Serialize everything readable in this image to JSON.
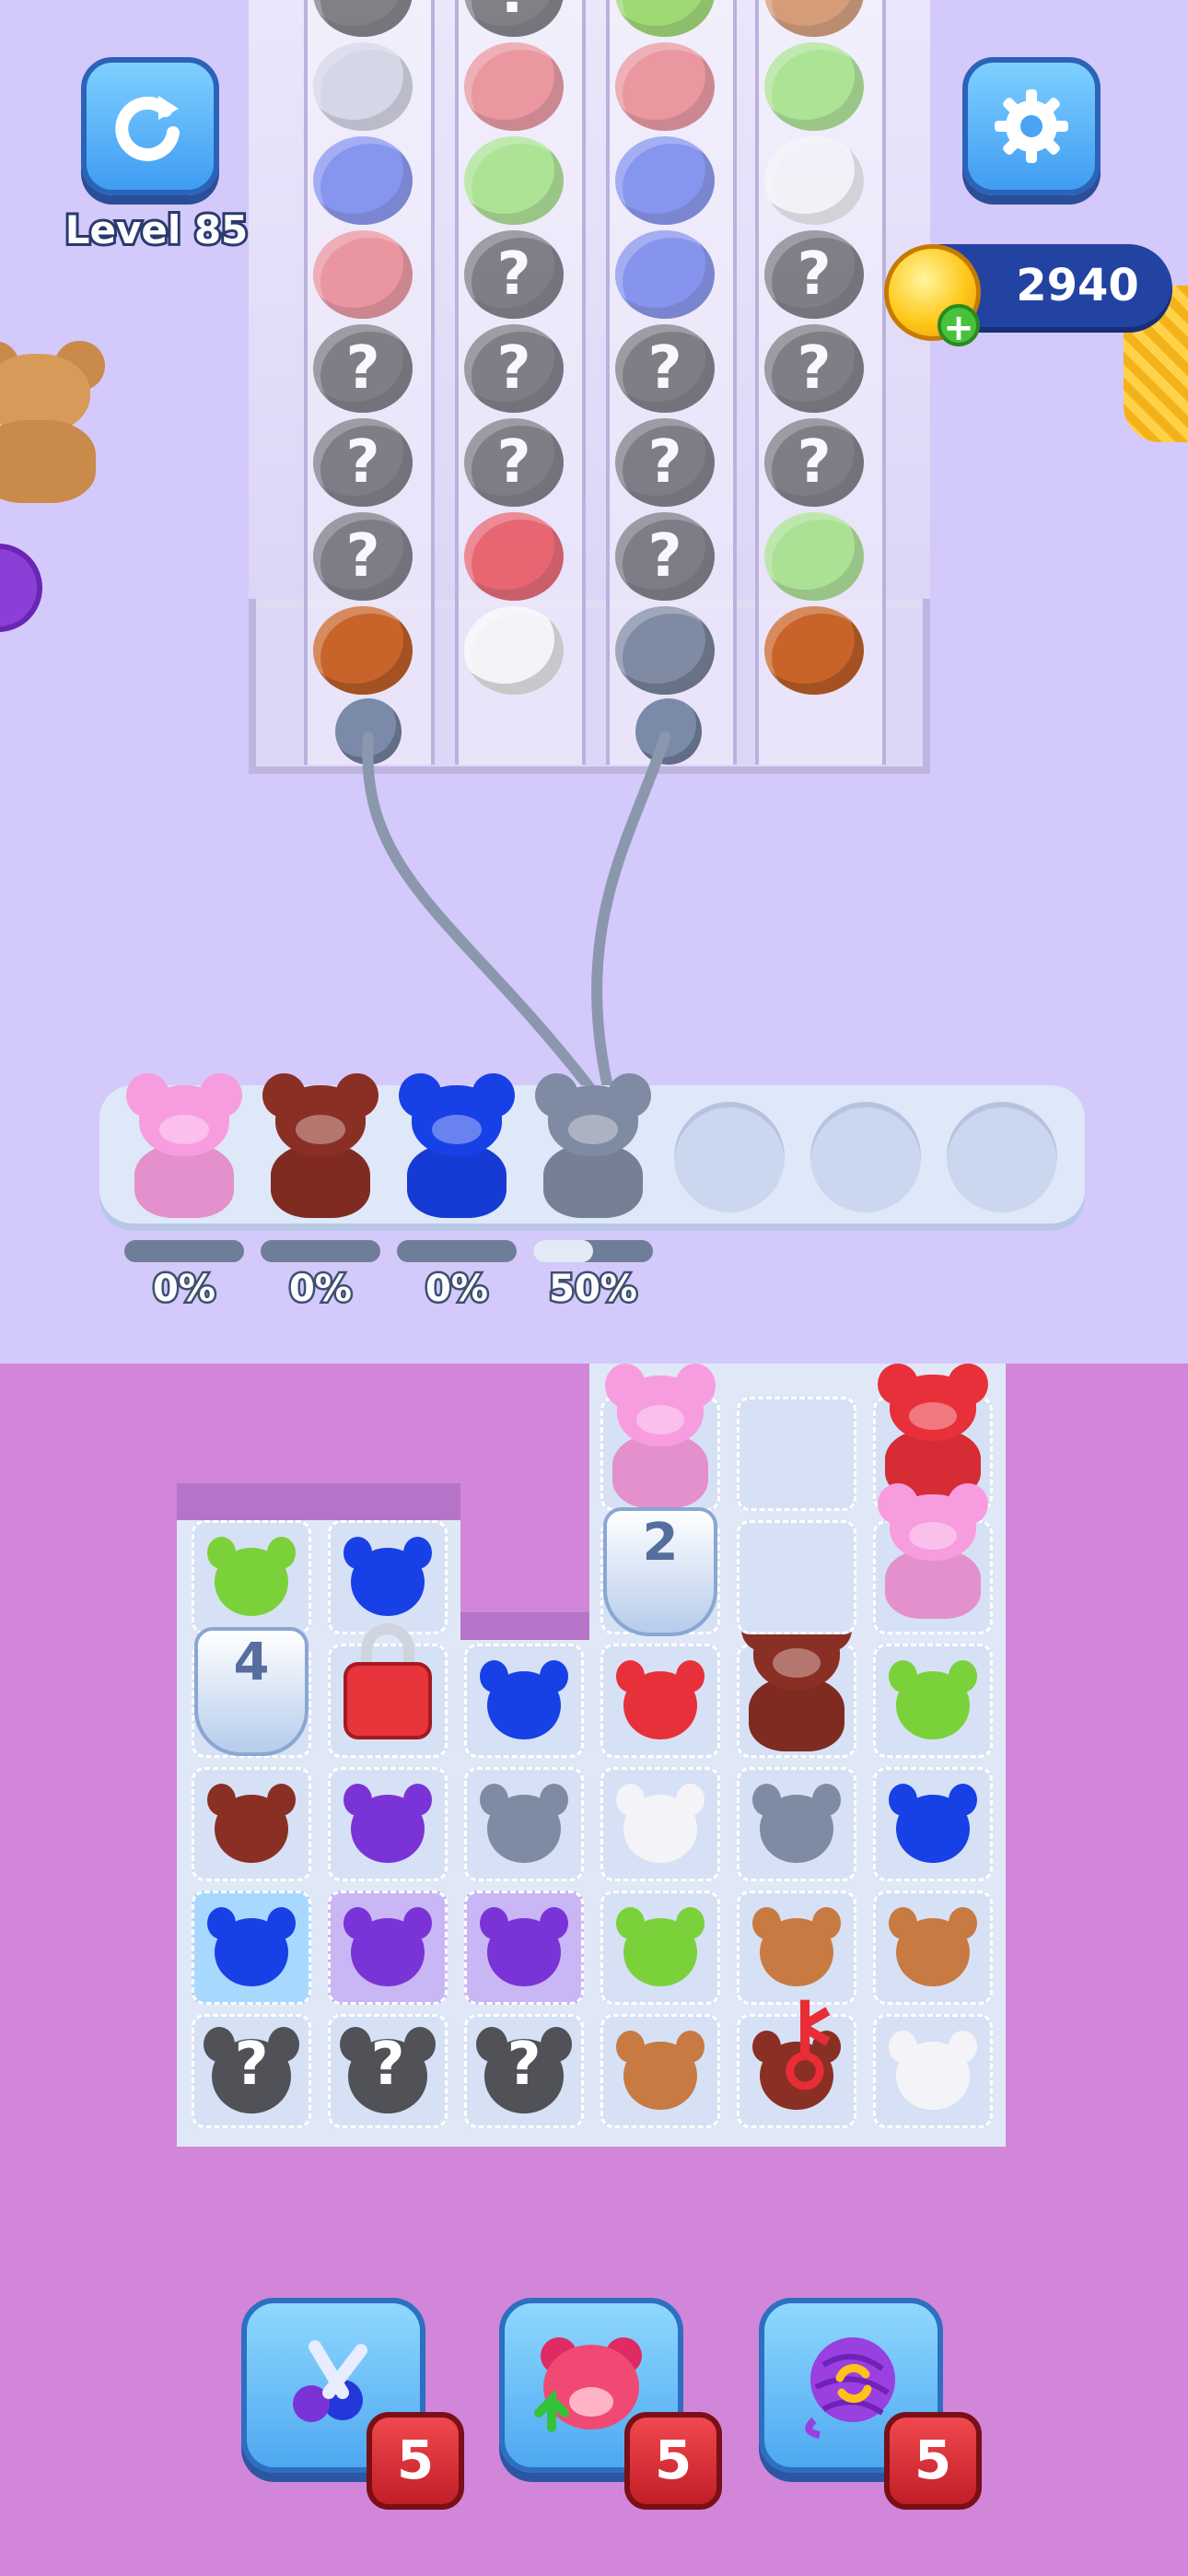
{
  "hud": {
    "level_label": "Level 85",
    "coins": "2940",
    "coin_plus": "+",
    "restart_icon": "restart-arrow-icon",
    "settings_icon": "gear-icon"
  },
  "colors": {
    "pink": "#f79ddf",
    "brown": "#8a2f24",
    "blue": "#1740e6",
    "gray": "#7f8aa3",
    "green": "#7bd13a",
    "red": "#e8303a",
    "purple": "#7a33d6",
    "white": "#f4f4f8",
    "tan": "#c87a43",
    "orange": "#c8642a",
    "dark": "#505257",
    "lightgray": "#c8cede",
    "periwinkle": "#5b71e8",
    "salmon": "#e8737a",
    "mint": "#90e06a"
  },
  "yarn_rack": {
    "columns": [
      [
        "dark",
        "lightgray",
        "periwinkle",
        "salmon",
        "?",
        "?",
        "?",
        "orange"
      ],
      [
        "?",
        "salmon",
        "mint",
        "?",
        "?",
        "?",
        "red",
        "white"
      ],
      [
        "green",
        "salmon",
        "periwinkle",
        "periwinkle",
        "?",
        "?",
        "?",
        "gray"
      ],
      [
        "tan",
        "mint",
        "white",
        "?",
        "?",
        "?",
        "mint",
        "orange"
      ]
    ],
    "question_mark": "?"
  },
  "slot_tray": {
    "slots": [
      {
        "color": "pink",
        "progress": 0,
        "label": "0%"
      },
      {
        "color": "brown",
        "progress": 0,
        "label": "0%"
      },
      {
        "color": "blue",
        "progress": 0,
        "label": "0%"
      },
      {
        "color": "gray",
        "progress": 0.5,
        "label": "50%"
      },
      {
        "color": null
      },
      {
        "color": null
      },
      {
        "color": null
      }
    ]
  },
  "board": {
    "cup_counts": [
      "2",
      "4"
    ],
    "question_mark": "?",
    "key_glyph": "⚷"
  },
  "boosters": [
    {
      "name": "scissors",
      "icon": "scissors-icon",
      "count": "5"
    },
    {
      "name": "bear-swap",
      "icon": "bear-lift-icon",
      "count": "5"
    },
    {
      "name": "yarn-shuffle",
      "icon": "yarn-shuffle-icon",
      "count": "5"
    }
  ]
}
